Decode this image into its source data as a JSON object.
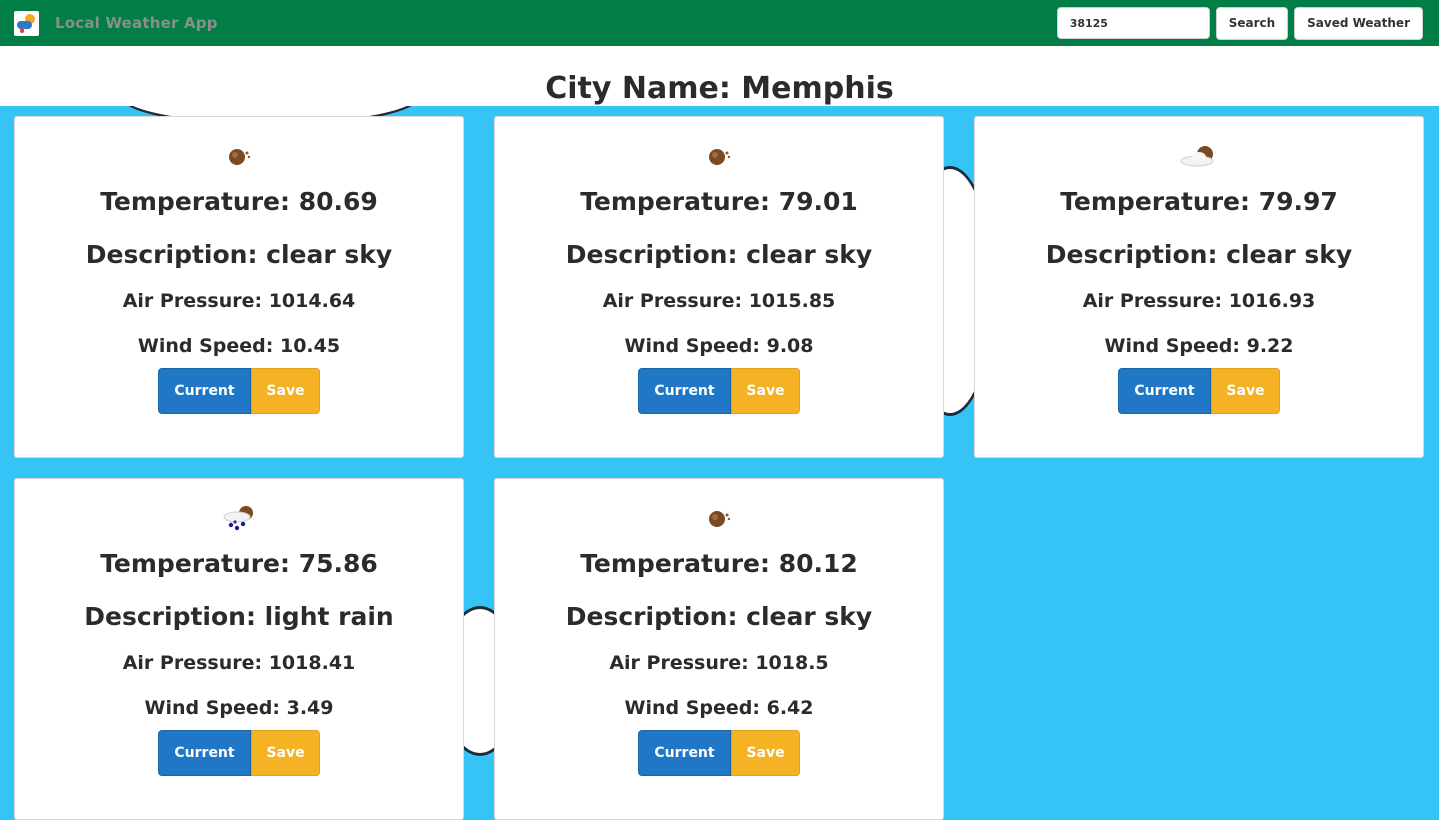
{
  "navbar": {
    "logo": "weather-app-logo-icon",
    "title": "Local Weather App",
    "search_value": "38125",
    "search_label": "Search",
    "saved_label": "Saved Weather"
  },
  "city": {
    "title": "City Name: Memphis"
  },
  "cards": [
    {
      "icon": "clear-sky-icon",
      "temperature": "Temperature: 80.69",
      "description": "Description: clear sky",
      "pressure": "Air Pressure: 1014.64",
      "wind": "Wind Speed: 10.45",
      "current_label": "Current",
      "save_label": "Save"
    },
    {
      "icon": "clear-sky-icon",
      "temperature": "Temperature: 79.01",
      "description": "Description: clear sky",
      "pressure": "Air Pressure: 1015.85",
      "wind": "Wind Speed: 9.08",
      "current_label": "Current",
      "save_label": "Save"
    },
    {
      "icon": "partly-cloudy-icon",
      "temperature": "Temperature: 79.97",
      "description": "Description: clear sky",
      "pressure": "Air Pressure: 1016.93",
      "wind": "Wind Speed: 9.22",
      "current_label": "Current",
      "save_label": "Save"
    },
    {
      "icon": "light-rain-icon",
      "temperature": "Temperature: 75.86",
      "description": "Description: light rain",
      "pressure": "Air Pressure: 1018.41",
      "wind": "Wind Speed: 3.49",
      "current_label": "Current",
      "save_label": "Save"
    },
    {
      "icon": "clear-sky-icon",
      "temperature": "Temperature: 80.12",
      "description": "Description: clear sky",
      "pressure": "Air Pressure: 1018.5",
      "wind": "Wind Speed: 6.42",
      "current_label": "Current",
      "save_label": "Save"
    }
  ],
  "colors": {
    "navbar": "#007e45",
    "sky": "#36c3f5",
    "current_button": "#1f77c6",
    "save_button": "#f5b225"
  }
}
